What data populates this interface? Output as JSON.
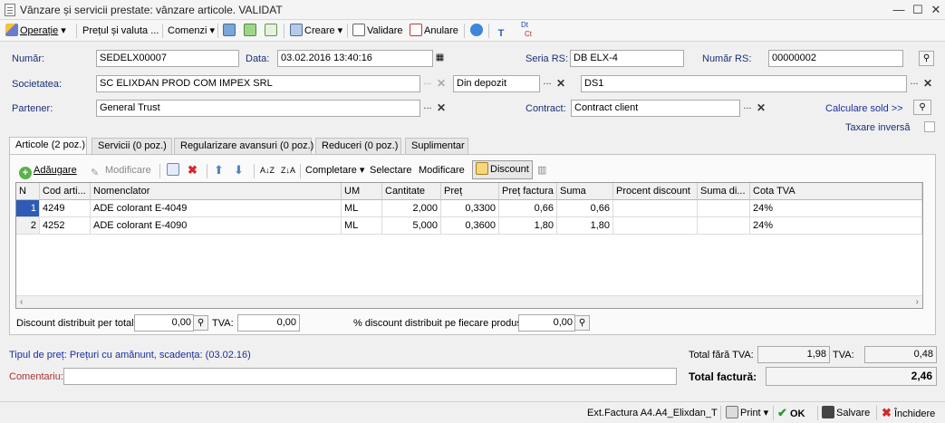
{
  "window": {
    "title": "Vânzare și servicii prestate: vânzare articole. VALIDAT"
  },
  "toolbar": {
    "operatie": "Operație",
    "pretul": "Prețul și valuta ...",
    "comenzi": "Comenzi",
    "creare": "Creare",
    "validare": "Validare",
    "anulare": "Anulare",
    "dtct_top": "Dt",
    "dtct_bottom": "Ct"
  },
  "form": {
    "numar_label": "Număr:",
    "numar": "SEDELX00007",
    "data_label": "Data:",
    "data": "03.02.2016 13:40:16",
    "seria_label": "Seria RS:",
    "seria": "DB ELX-4",
    "numar_rs_label": "Număr RS:",
    "numar_rs": "00000002",
    "societatea_label": "Societatea:",
    "societatea": "SC ELIXDAN PROD COM IMPEX SRL",
    "depozit": "Din depozit",
    "ds": "DS1",
    "partener_label": "Partener:",
    "partener": "General Trust",
    "contract_label": "Contract:",
    "contract": "Contract client",
    "calculare_sold": "Calculare sold >>",
    "taxare_inversa": "Taxare inversă"
  },
  "tabs": [
    "Articole (2 poz.)",
    "Servicii (0 poz.)",
    "Regularizare avansuri (0 poz.)",
    "Reduceri (0 poz.)",
    "Suplimentar"
  ],
  "grid_toolbar": {
    "adaugare": "Adăugare",
    "modificare": "Modificare",
    "completare": "Completare",
    "selectare": "Selectare",
    "modificare2": "Modificare",
    "discount": "Discount"
  },
  "table": {
    "columns": [
      "N",
      "Cod arti...",
      "Nomenclator",
      "UM",
      "Cantitate",
      "Preț",
      "Preț factura",
      "Suma",
      "Procent discount",
      "Suma di...",
      "Cota TVA"
    ],
    "rows": [
      [
        "1",
        "4249",
        "ADE colorant E-4049",
        "ML",
        "2,000",
        "0,3300",
        "0,66",
        "0,66",
        "",
        "",
        "24%"
      ],
      [
        "2",
        "4252",
        "ADE colorant E-4090",
        "ML",
        "5,000",
        "0,3600",
        "1,80",
        "1,80",
        "",
        "",
        "24%"
      ]
    ]
  },
  "discount": {
    "per_total_label": "Discount distribuit per total:",
    "per_total": "0,00",
    "tva_label": "TVA:",
    "tva": "0,00",
    "per_produs_label": "% discount distribuit pe fiecare produs:",
    "per_produs": "0,00"
  },
  "footer": {
    "tipul_pret": "Tipul de preț: Prețuri cu amănunt, scadența:",
    "scadenta": "(03.02.16)",
    "total_fara_tva_label": "Total fără TVA:",
    "total_fara_tva": "1,98",
    "tva_label": "TVA:",
    "tva": "0,48",
    "comentariu_label": "Comentariu:",
    "comentariu": "",
    "total_factura_label": "Total factură:",
    "total_factura": "2,46"
  },
  "statusbar": {
    "ext_factura": "Ext.Factura A4.A4_Elixdan_T",
    "print": "Print",
    "ok": "OK",
    "salvare": "Salvare",
    "inchidere": "Închidere"
  }
}
